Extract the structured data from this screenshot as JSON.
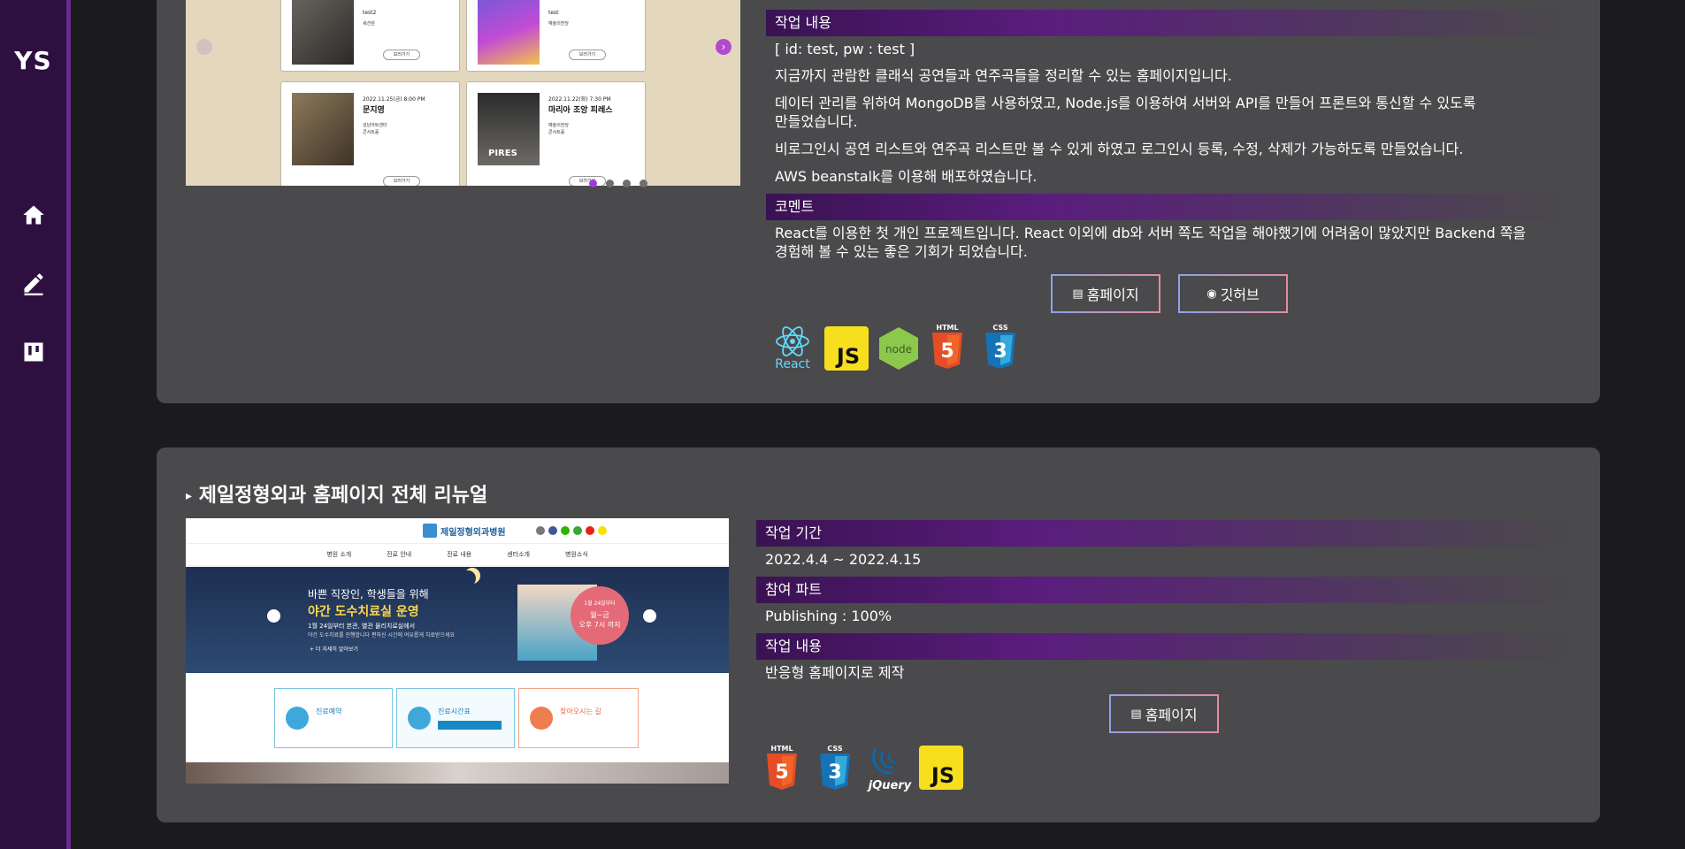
{
  "sidebar": {
    "logo": "YS",
    "nav": [
      {
        "icon": "home-icon"
      },
      {
        "icon": "pencil-icon"
      },
      {
        "icon": "board-icon"
      }
    ]
  },
  "project1": {
    "slider": {
      "cards": [
        {
          "t1": "test2",
          "t2": "",
          "t3": "세션원",
          "btn": "보러가기"
        },
        {
          "t1": "test",
          "t2": "",
          "t3": "예술의전당",
          "btn": "보러가기"
        },
        {
          "t1": "2022.11.25(금) 8:00 PM",
          "t2": "문지영",
          "t3": "성남아트센터\n콘서트홀",
          "btn": "보러가기"
        },
        {
          "t1": "2022.11.22(화) 7:30 PM",
          "t2": "마리아 조앙 피레스",
          "t3": "예술의전당\n콘서트홀",
          "btn": "보러가기"
        }
      ],
      "cover_text": "PIRES"
    },
    "work_label": "작업 내용",
    "work_lines": [
      "[ id: test, pw : test ]",
      "지금까지 관람한 클래식 공연들과 연주곡들을 정리할 수 있는 홈페이지입니다.",
      "데이터 관리를 위하여 MongoDB를 사용하였고, Node.js를 이용하여 서버와 API를 만들어 프론트와 통신할 수 있도록",
      "만들었습니다.",
      "비로그인시 공연 리스트와 연주곡 리스트만 볼 수 있게 하였고 로그인시 등록, 수정, 삭제가 가능하도록 만들었습니다.",
      "AWS beanstalk를 이용해 배포하였습니다."
    ],
    "comment_label": "코멘트",
    "comment_lines": [
      "React를 이용한 첫 개인 프로젝트입니다. React 이외에 db와 서버 쪽도 작업을 해야했기에 어려움이 많았지만 Backend 쪽을",
      "경험해 볼 수 있는 좋은 기회가 되었습니다."
    ],
    "btn_home": "홈페이지",
    "btn_github": "깃허브",
    "tech": [
      {
        "name": "React",
        "label": "React"
      },
      {
        "name": "JS",
        "label": "JS"
      },
      {
        "name": "Node",
        "label": "node"
      },
      {
        "name": "HTML",
        "label": "HTML"
      },
      {
        "name": "CSS",
        "label": "CSS"
      }
    ]
  },
  "project2": {
    "title": "제일정형외과 홈페이지 전체 리뉴얼",
    "screenshot": {
      "logo_text": "제일정형외과병원",
      "menu": [
        "병원 소개",
        "진료 안내",
        "진료 내용",
        "센터소개",
        "병원소식"
      ],
      "banner_line1": "바쁜 직장인, 학생들을 위해",
      "banner_line2": "야간 도수치료실 운영",
      "banner_line3": "1월 24일부터 본관, 별관 물리치료실에서",
      "banner_line4": "야간 도수치료를 진행합니다 편하신 시간에 여유롭게 치료받으세요",
      "banner_more": "+ 더 자세히 알아보기",
      "badge_line1": "1월 24일부터",
      "badge_line2": "월~금",
      "badge_line3": "오후 7시 까지",
      "box1": "진료예약",
      "box2": "진료시간표",
      "box3": "찾아오시는 길"
    },
    "period_label": "작업 기간",
    "period_value": "2022.4.4 ~ 2022.4.15",
    "part_label": "참여 파트",
    "part_value": "Publishing : 100%",
    "work_label": "작업 내용",
    "work_value": "반응형 홈페이지로 제작",
    "btn_home": "홈페이지",
    "tech": [
      {
        "name": "HTML",
        "label": "HTML"
      },
      {
        "name": "CSS",
        "label": "CSS"
      },
      {
        "name": "jQuery",
        "label": "jQuery"
      },
      {
        "name": "JS",
        "label": "JS"
      }
    ]
  },
  "colors": {
    "accent": "#a13bd6",
    "sidebar": "#2e1040",
    "card": "#4a494b"
  }
}
